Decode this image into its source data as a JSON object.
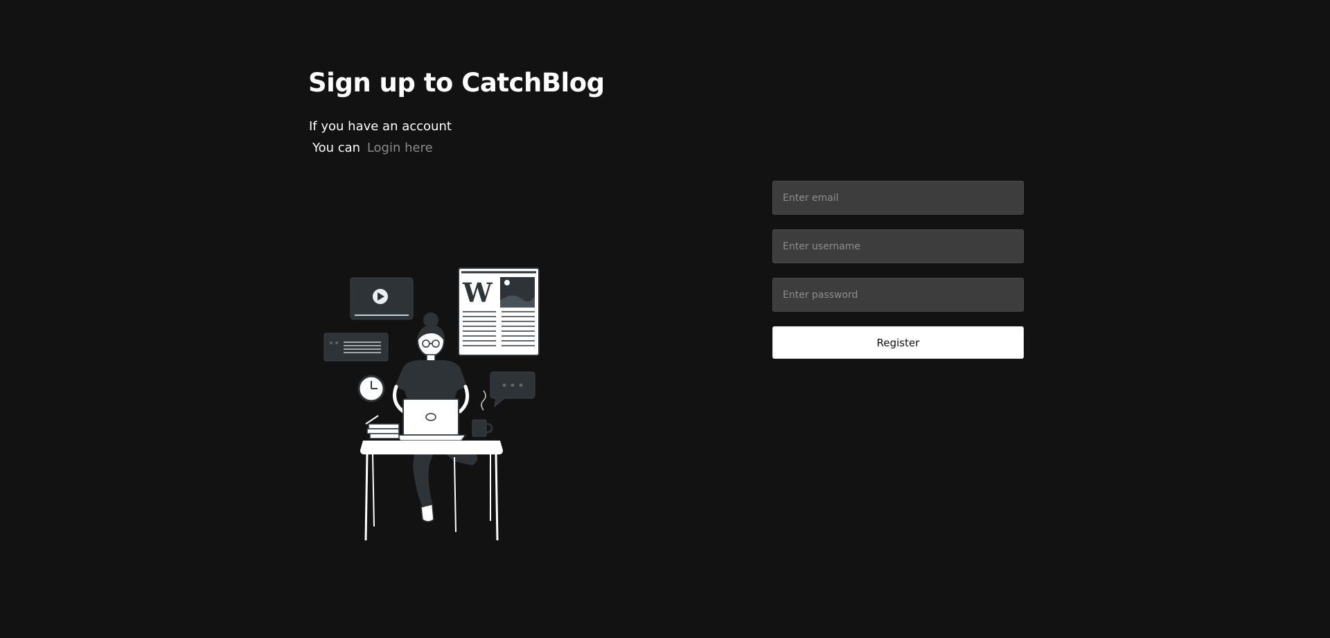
{
  "heading": {
    "title": "Sign up to CatchBlog",
    "line1": "If you have an account",
    "line2_prefix": "You can",
    "login_link": "Login here"
  },
  "form": {
    "email_placeholder": "Enter email",
    "username_placeholder": "Enter username",
    "password_placeholder": "Enter password",
    "register_label": "Register"
  },
  "illustration": {
    "newspaper_letter": "W"
  },
  "colors": {
    "background": "#121212",
    "input_background": "#3d3d3d",
    "link": "#8a8a8a",
    "button_background": "#ffffff"
  }
}
